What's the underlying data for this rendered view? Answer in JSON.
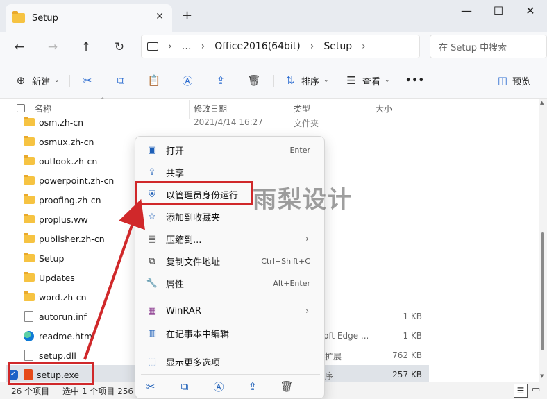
{
  "window": {
    "tab_title": "Setup",
    "tab_close": "✕",
    "new_tab": "+",
    "minimize": "—",
    "maximize": "☐",
    "close": "✕"
  },
  "nav": {
    "back": "←",
    "forward": "→",
    "up": "↑",
    "refresh": "↻",
    "breadcrumb": [
      "…",
      "Office2016(64bit)",
      "Setup"
    ],
    "search_placeholder": "在 Setup 中搜索"
  },
  "toolbar": {
    "new_label": "新建",
    "sort_label": "排序",
    "view_label": "查看",
    "more": "•••",
    "preview_label": "预览"
  },
  "columns": {
    "name": "名称",
    "date": "修改日期",
    "type": "类型",
    "size": "大小"
  },
  "files": [
    {
      "name": "osm.zh-cn",
      "date": "2021/4/14 16:27",
      "type": "文件夹",
      "size": ""
    },
    {
      "name": "osmux.zh-cn",
      "date": "",
      "type": "",
      "size": ""
    },
    {
      "name": "outlook.zh-cn",
      "date": "",
      "type": "",
      "size": ""
    },
    {
      "name": "powerpoint.zh-cn",
      "date": "",
      "type": "",
      "size": ""
    },
    {
      "name": "proofing.zh-cn",
      "date": "",
      "type": "",
      "size": ""
    },
    {
      "name": "proplus.ww",
      "date": "",
      "type": "",
      "size": ""
    },
    {
      "name": "publisher.zh-cn",
      "date": "",
      "type": "",
      "size": ""
    },
    {
      "name": "Setup",
      "date": "",
      "type": "",
      "size": ""
    },
    {
      "name": "Updates",
      "date": "",
      "type": "",
      "size": ""
    },
    {
      "name": "word.zh-cn",
      "date": "",
      "type": "",
      "size": ""
    },
    {
      "name": "autorun.inf",
      "date": "",
      "type": "",
      "size": "1 KB"
    },
    {
      "name": "readme.htm",
      "date": "",
      "type": "oft Edge ...",
      "size": "1 KB"
    },
    {
      "name": "setup.dll",
      "date": "",
      "type": "扩展",
      "size": "762 KB"
    },
    {
      "name": "setup.exe",
      "date": "",
      "type": "序",
      "size": "257 KB"
    }
  ],
  "status": {
    "count": "26 个项目",
    "selected": "选中 1 个项目  256"
  },
  "context_menu": {
    "open": {
      "label": "打开",
      "shortcut": "Enter"
    },
    "share": {
      "label": "共享"
    },
    "run_as_admin": {
      "label": "以管理员身份运行"
    },
    "add_favorites": {
      "label": "添加到收藏夹"
    },
    "compress": {
      "label": "压缩到...",
      "arrow": "›"
    },
    "copy_path": {
      "label": "复制文件地址",
      "shortcut": "Ctrl+Shift+C"
    },
    "properties": {
      "label": "属性",
      "shortcut": "Alt+Enter"
    },
    "winrar": {
      "label": "WinRAR",
      "arrow": "›"
    },
    "notepad": {
      "label": "在记事本中编辑"
    },
    "more_options": {
      "label": "显示更多选项"
    }
  },
  "watermark": "雨梨设计",
  "colors": {
    "highlight_red": "#d0282a",
    "accent_blue": "#1d63c7",
    "folder_yellow": "#f6c342"
  }
}
